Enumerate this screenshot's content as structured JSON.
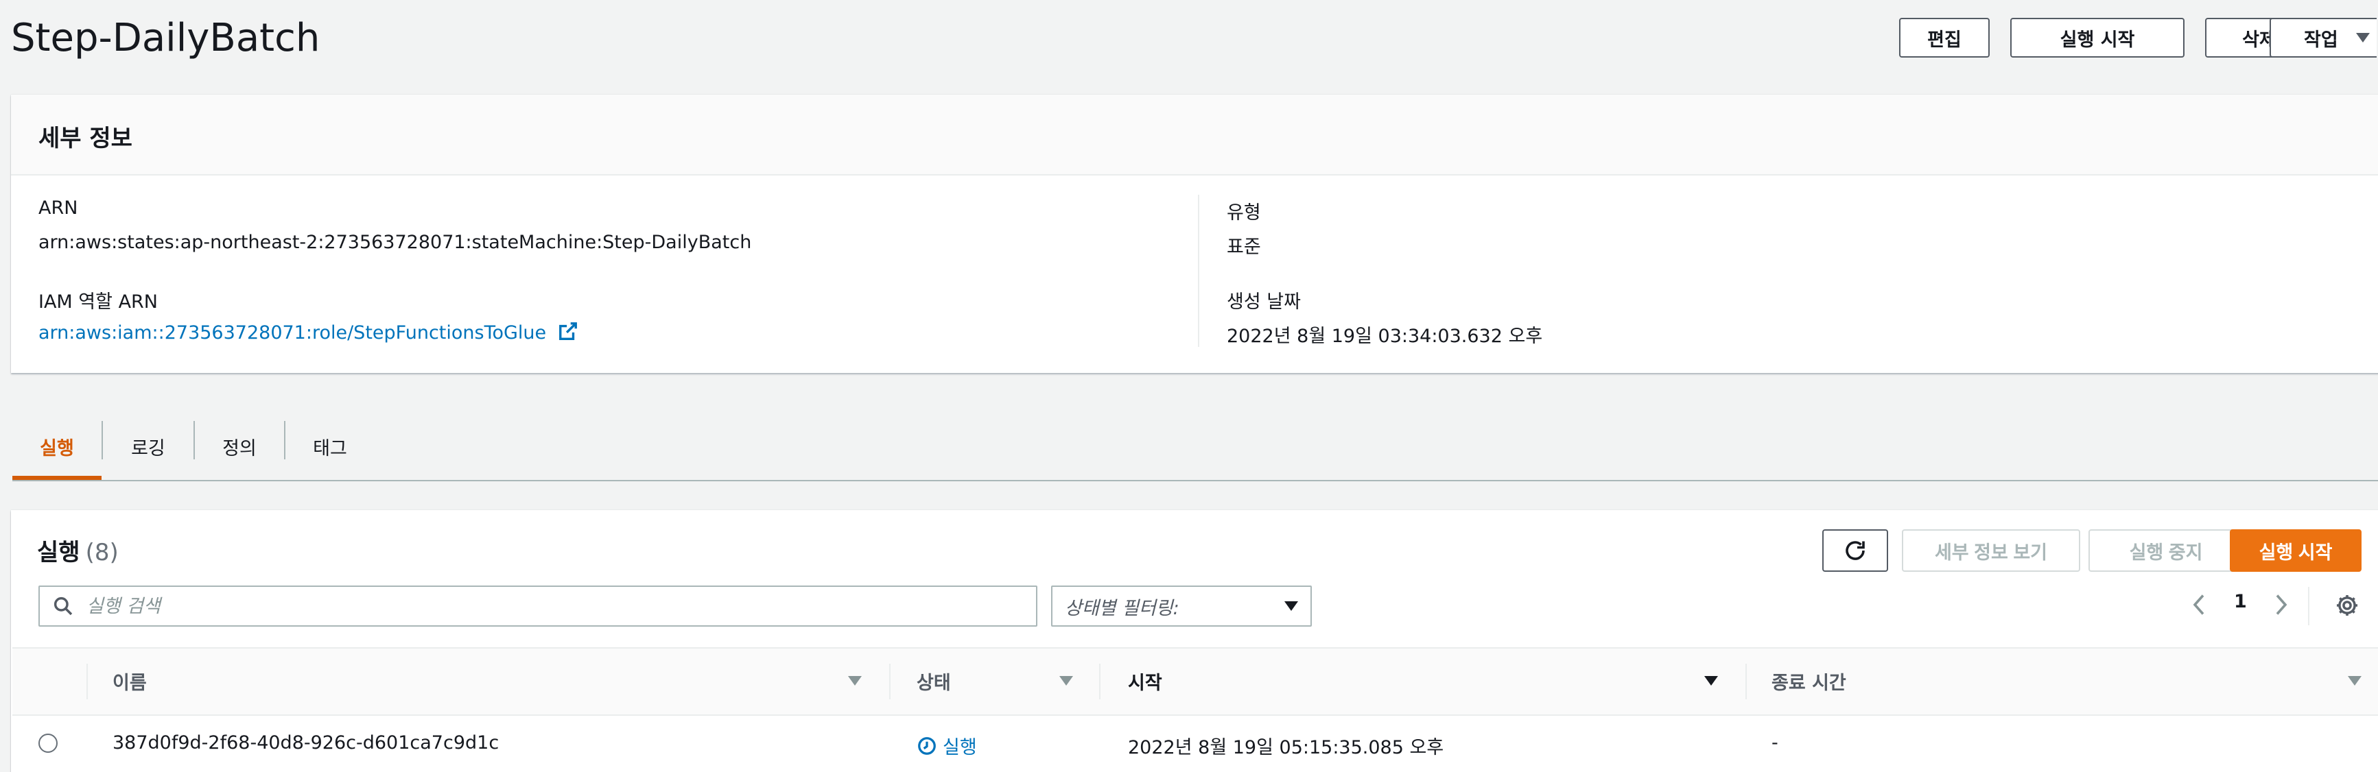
{
  "header": {
    "title": "Step-DailyBatch",
    "buttons": {
      "edit": "편집",
      "start_execution": "실행 시작",
      "delete": "삭제",
      "actions": "작업"
    }
  },
  "details": {
    "title": "세부 정보",
    "arn_label": "ARN",
    "arn_value": "arn:aws:states:ap-northeast-2:273563728071:stateMachine:Step-DailyBatch",
    "iam_label": "IAM 역할 ARN",
    "iam_value": "arn:aws:iam::273563728071:role/StepFunctionsToGlue",
    "type_label": "유형",
    "type_value": "표준",
    "created_label": "생성 날짜",
    "created_value": "2022년 8월 19일 03:34:03.632 오후"
  },
  "tabs": [
    {
      "label": "실행",
      "active": true
    },
    {
      "label": "로깅",
      "active": false
    },
    {
      "label": "정의",
      "active": false
    },
    {
      "label": "태그",
      "active": false
    }
  ],
  "executions": {
    "title": "실행",
    "count": "(8)",
    "buttons": {
      "view_details": "세부 정보 보기",
      "stop": "실행 중지",
      "start": "실행 시작"
    },
    "search_placeholder": "실행 검색",
    "filter_placeholder": "상태별 필터링:",
    "page": "1",
    "columns": [
      "이름",
      "상태",
      "시작",
      "종료 시간"
    ],
    "rows": [
      {
        "name": "387d0f9d-2f68-40d8-926c-d601ca7c9d1c",
        "status": "실행",
        "start": "2022년 8월 19일 05:15:35.085 오후",
        "end": "-"
      }
    ]
  },
  "colors": {
    "accent": "#ec7211",
    "tab_active": "#d45b07",
    "link": "#0073bb"
  },
  "icons": [
    "external-link-icon",
    "refresh-icon",
    "search-icon",
    "caret-down-icon",
    "chevron-left-icon",
    "chevron-right-icon",
    "gear-icon",
    "clock-icon"
  ]
}
